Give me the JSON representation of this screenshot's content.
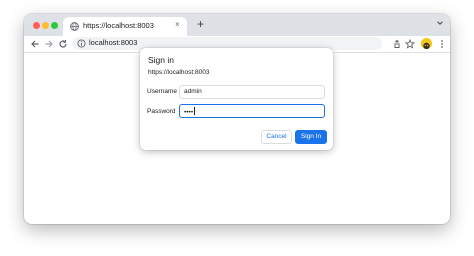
{
  "tab": {
    "title": "https://localhost:8003",
    "close_glyph": "×"
  },
  "new_tab_glyph": "+",
  "omnibox": {
    "url_host": "localhost",
    "url_port": ":8003"
  },
  "dialog": {
    "heading": "Sign in",
    "origin": "https://localhost:8003",
    "username_label": "Username",
    "username_value": "admin",
    "password_label": "Password",
    "password_value": "••••",
    "cancel_label": "Cancel",
    "signin_label": "Sign In"
  },
  "colors": {
    "accent": "#1a73e8",
    "tabstrip": "#dee1e6",
    "traffic_close": "#ff5f57",
    "traffic_minimize": "#febc2e",
    "traffic_zoom": "#28c840"
  },
  "icons": [
    "globe-icon",
    "close-icon",
    "plus-icon",
    "chevron-down-icon",
    "back-arrow-icon",
    "forward-arrow-icon",
    "reload-icon",
    "info-icon",
    "share-icon",
    "star-icon",
    "avatar",
    "more-menu-icon"
  ]
}
